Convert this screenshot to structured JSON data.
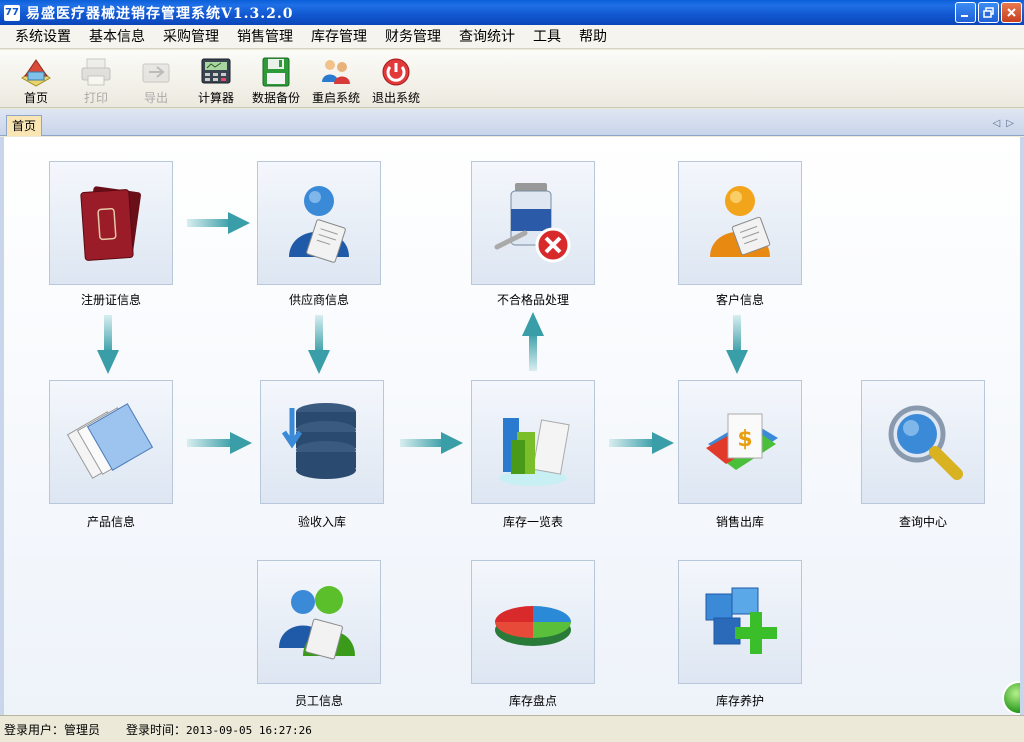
{
  "window": {
    "title": "易盛医疗器械进销存管理系统V1.3.2.0",
    "app_icon_text": "77"
  },
  "menu": {
    "items": [
      "系统设置",
      "基本信息",
      "采购管理",
      "销售管理",
      "库存管理",
      "财务管理",
      "查询统计",
      "工具",
      "帮助"
    ]
  },
  "toolbar": {
    "items": [
      {
        "label": "首页",
        "icon": "home-icon",
        "enabled": true
      },
      {
        "label": "打印",
        "icon": "printer-icon",
        "enabled": false
      },
      {
        "label": "导出",
        "icon": "export-icon",
        "enabled": false
      },
      {
        "label": "计算器",
        "icon": "calculator-icon",
        "enabled": true
      },
      {
        "label": "数据备份",
        "icon": "floppy-disk-icon",
        "enabled": true
      },
      {
        "label": "重启系统",
        "icon": "users-restart-icon",
        "enabled": true
      },
      {
        "label": "退出系统",
        "icon": "power-icon",
        "enabled": true
      }
    ]
  },
  "tabs": {
    "active": "首页"
  },
  "modules": {
    "registration": "注册证信息",
    "supplier": "供应商信息",
    "defective": "不合格品处理",
    "customer": "客户信息",
    "product": "产品信息",
    "receiving": "验收入库",
    "inventory_list": "库存一览表",
    "sales_out": "销售出库",
    "query_center": "查询中心",
    "employee": "员工信息",
    "stocktake": "库存盘点",
    "maintenance": "库存养护"
  },
  "status": {
    "user_label": "登录用户：",
    "user_value": "管理员",
    "time_label": "登录时间：",
    "time_value": "2013-09-05 16:27:26"
  },
  "colors": {
    "titlebar": "#1257d0",
    "arrow": "#4aa8b0",
    "tile_border": "#b9c7da"
  }
}
